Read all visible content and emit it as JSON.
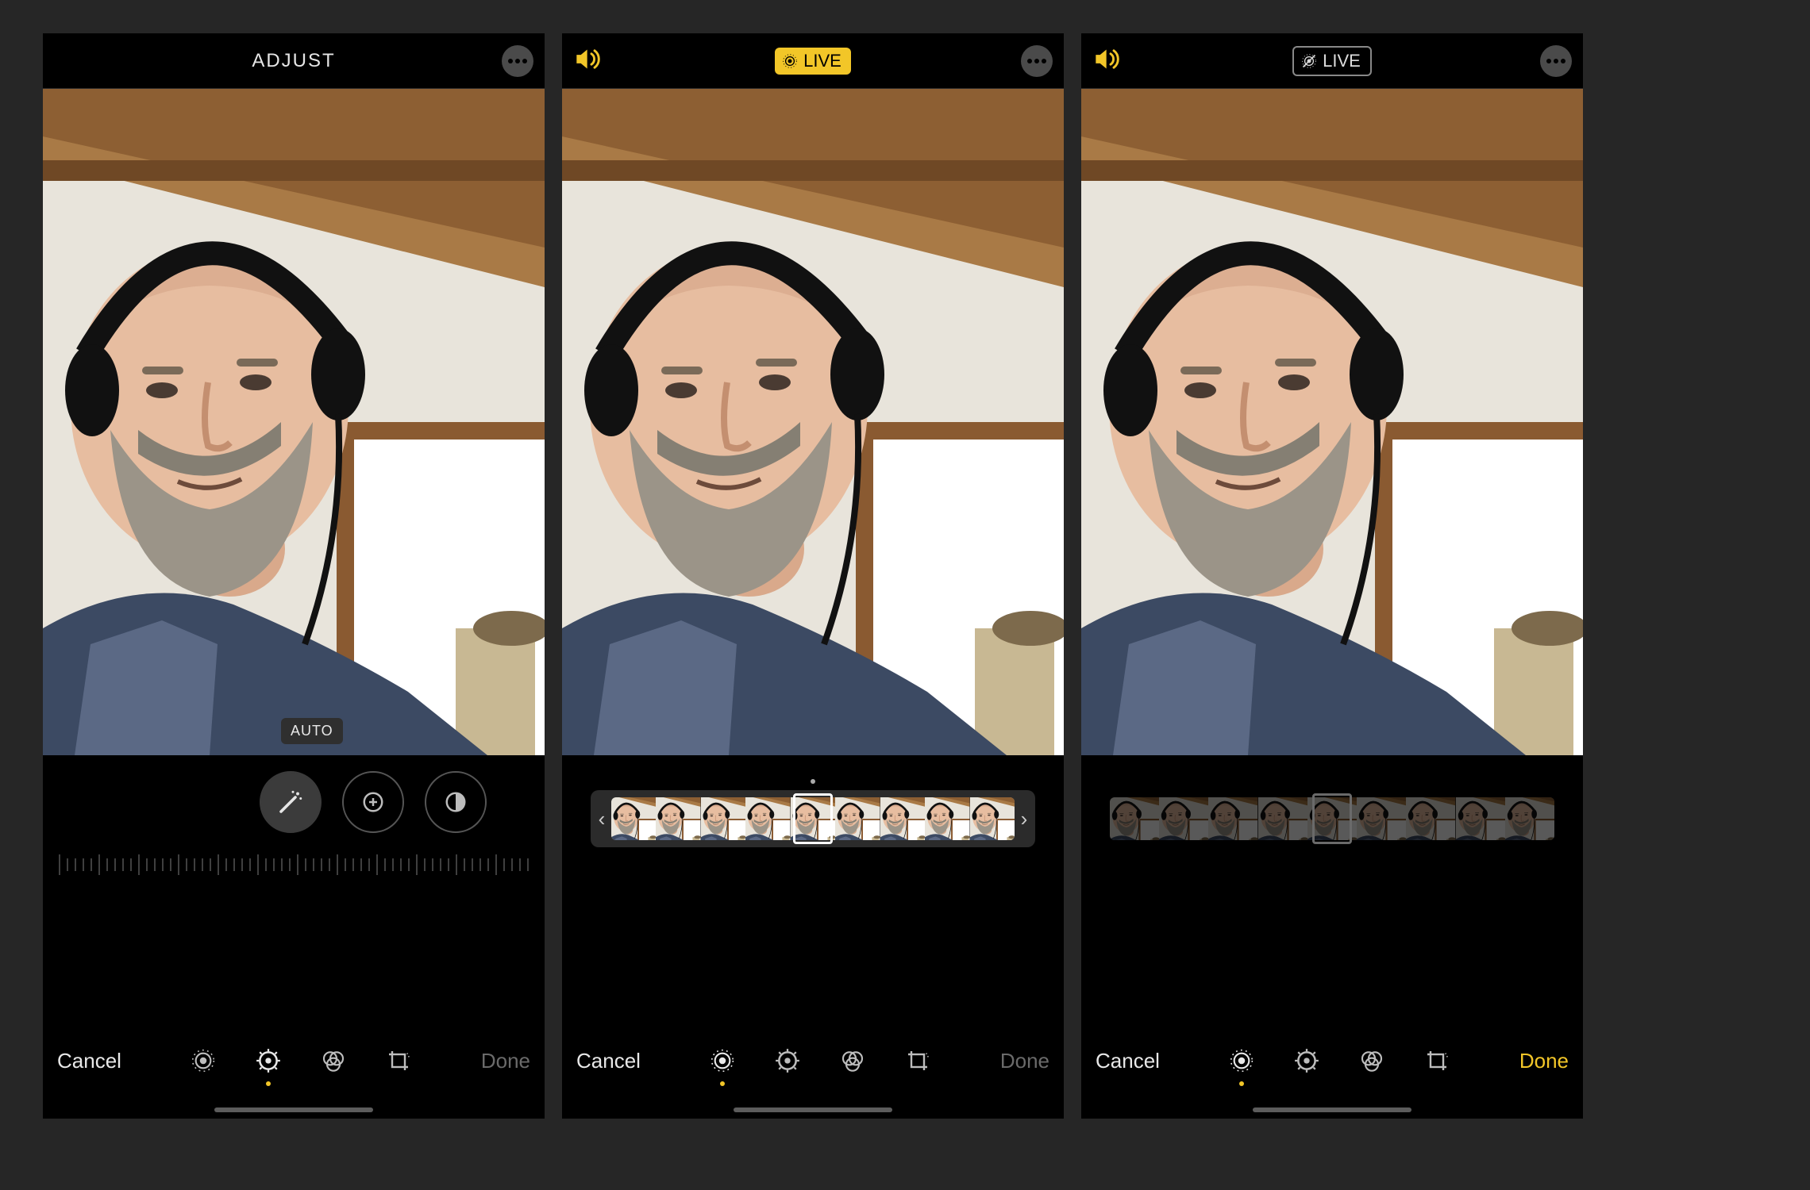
{
  "screens": {
    "adjust": {
      "title": "ADJUST",
      "auto_chip": "AUTO",
      "cancel": "Cancel",
      "done": "Done",
      "done_state": "grey",
      "toolbar_active": "adjust"
    },
    "live_on": {
      "live_label": "LIVE",
      "live_state": "on",
      "cancel": "Cancel",
      "done": "Done",
      "done_state": "grey",
      "toolbar_active": "live"
    },
    "live_off": {
      "live_label": "LIVE",
      "live_state": "off",
      "cancel": "Cancel",
      "done": "Done",
      "done_state": "yellow",
      "toolbar_active": "live"
    }
  },
  "colors": {
    "accent": "#f2c628",
    "bg": "#000000",
    "page_bg": "#262626"
  },
  "icons": {
    "more": "more-icon",
    "speaker": "speaker-icon",
    "live": "live-photo-icon",
    "live_off": "live-photo-off-icon",
    "wand": "magic-wand-icon",
    "exposure": "exposure-plus-icon",
    "contrast": "contrast-icon",
    "tool_live": "live-photo-icon",
    "tool_adjust": "adjust-dial-icon",
    "tool_filters": "filters-icon",
    "tool_crop": "crop-rotate-icon"
  }
}
